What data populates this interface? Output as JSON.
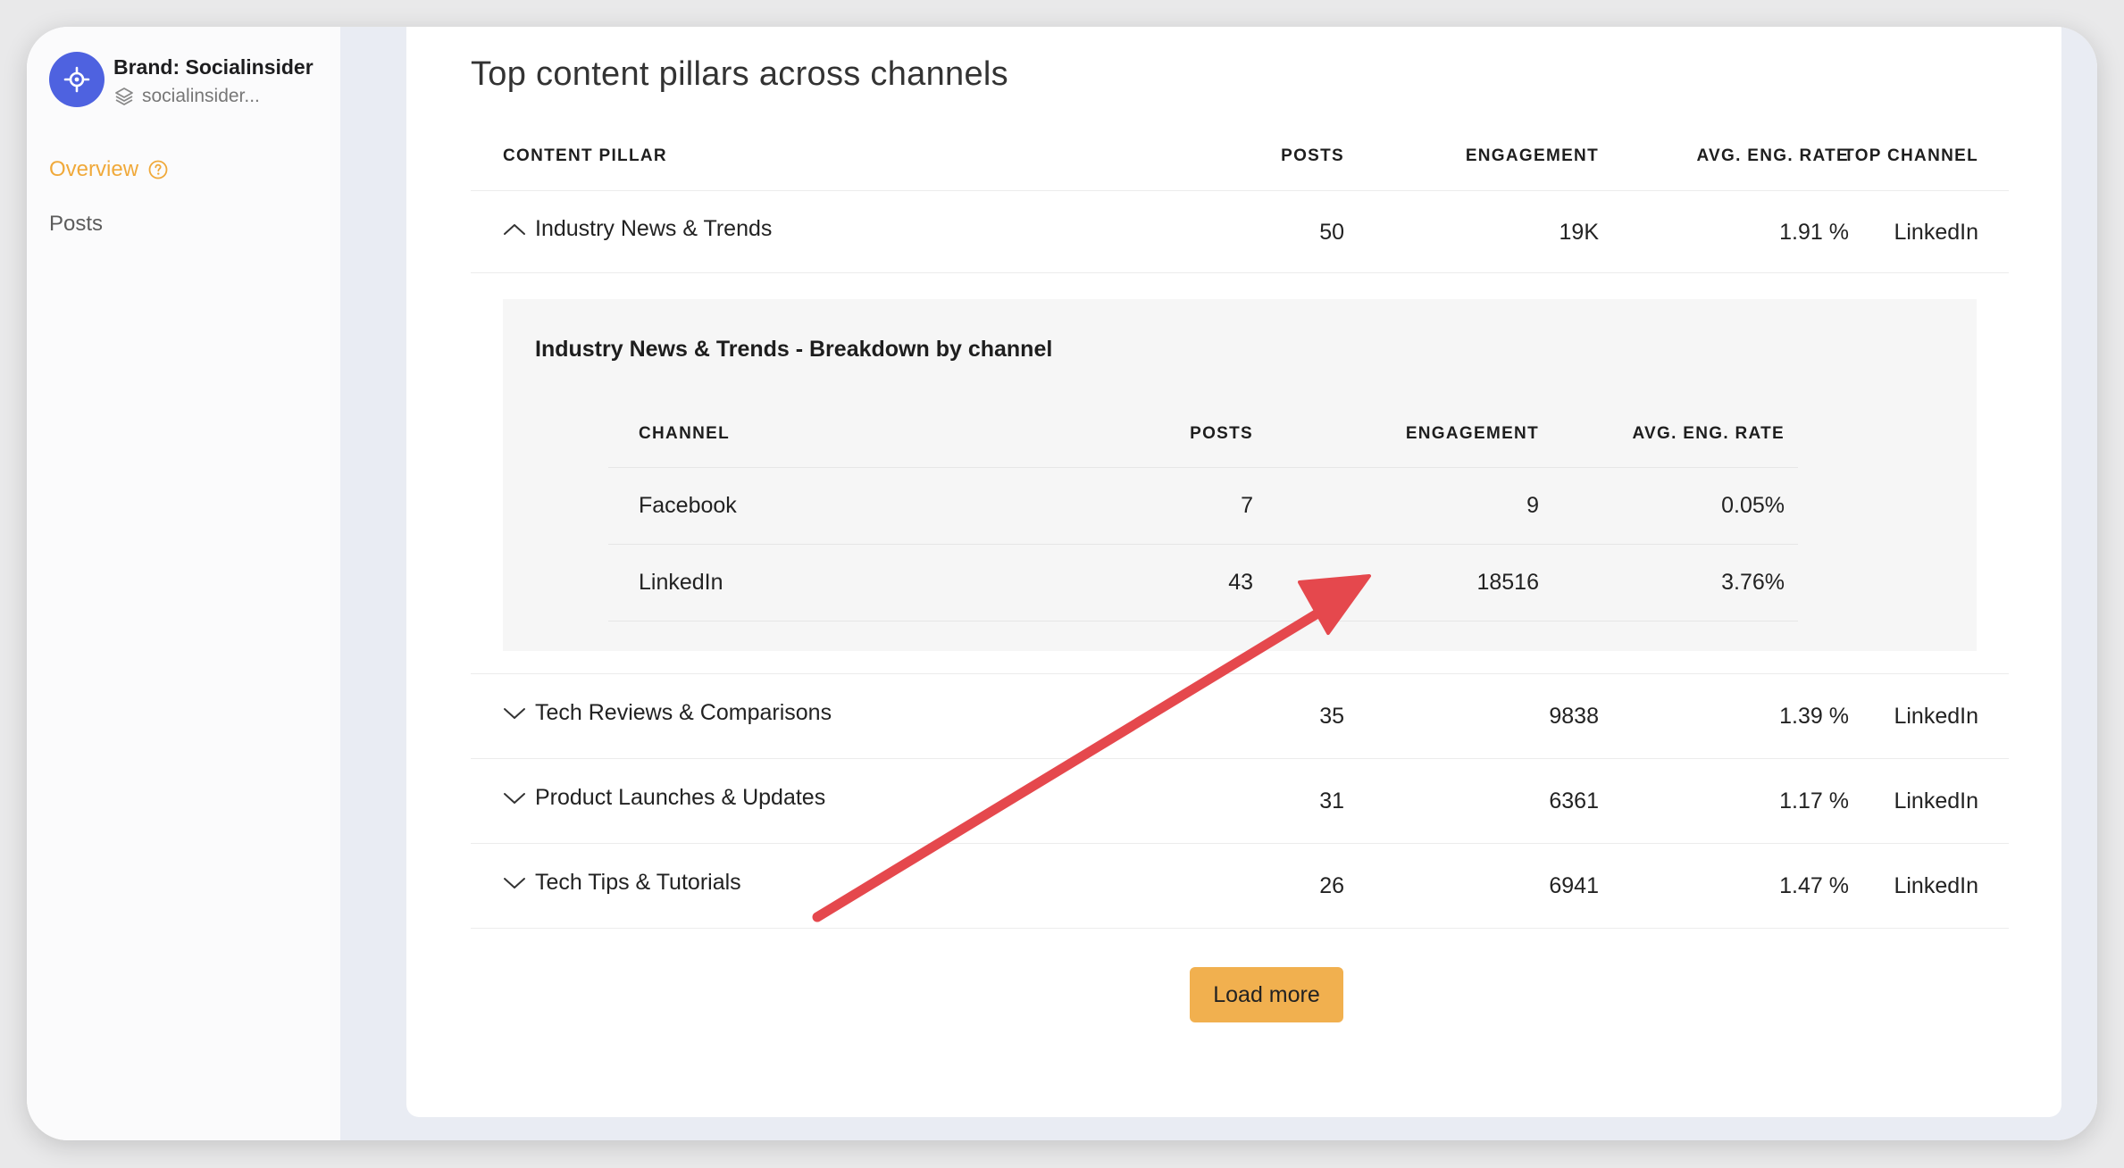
{
  "sidebar": {
    "brand_name": "Brand: Socialinsider",
    "brand_sub": "socialinsider...",
    "nav": {
      "overview": "Overview",
      "posts": "Posts"
    }
  },
  "main": {
    "title": "Top content pillars across channels",
    "headers": {
      "pillar": "CONTENT PILLAR",
      "posts": "POSTS",
      "engagement": "ENGAGEMENT",
      "rate": "AVG. ENG. RATE",
      "channel": "TOP CHANNEL"
    },
    "rows": [
      {
        "pillar": "Industry News & Trends",
        "posts": "50",
        "engagement": "19K",
        "rate": "1.91 %",
        "channel": "LinkedIn",
        "expanded": true
      },
      {
        "pillar": "Tech Reviews & Comparisons",
        "posts": "35",
        "engagement": "9838",
        "rate": "1.39 %",
        "channel": "LinkedIn",
        "expanded": false
      },
      {
        "pillar": "Product Launches & Updates",
        "posts": "31",
        "engagement": "6361",
        "rate": "1.17 %",
        "channel": "LinkedIn",
        "expanded": false
      },
      {
        "pillar": "Tech Tips & Tutorials",
        "posts": "26",
        "engagement": "6941",
        "rate": "1.47 %",
        "channel": "LinkedIn",
        "expanded": false
      }
    ],
    "breakdown": {
      "title": "Industry News & Trends - Breakdown by channel",
      "headers": {
        "channel": "CHANNEL",
        "posts": "POSTS",
        "engagement": "ENGAGEMENT",
        "rate": "AVG. ENG. RATE"
      },
      "rows": [
        {
          "channel": "Facebook",
          "posts": "7",
          "engagement": "9",
          "rate": "0.05%"
        },
        {
          "channel": "LinkedIn",
          "posts": "43",
          "engagement": "18516",
          "rate": "3.76%"
        }
      ]
    },
    "load_more": "Load more"
  },
  "colors": {
    "accent": "#f1b04f",
    "overview_active": "#f0a93a",
    "brand_logo": "#4e62e0",
    "annotation_arrow": "#e5484d"
  },
  "icons": {
    "brand": "crosshair-icon",
    "sub": "layers-icon",
    "help": "help-circle-icon",
    "expanded": "chevron-up-icon",
    "collapsed": "chevron-down-icon"
  }
}
